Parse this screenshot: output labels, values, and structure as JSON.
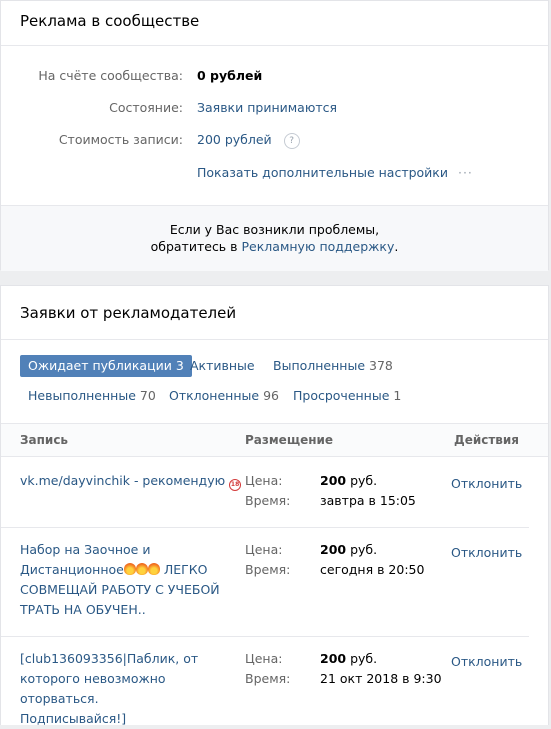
{
  "ads": {
    "title": "Реклама в сообществе",
    "balance": {
      "label": "На счёте сообщества:",
      "value": "0 рублей"
    },
    "status": {
      "label": "Состояние:",
      "value": "Заявки принимаются"
    },
    "price": {
      "label": "Стоимость записи:",
      "value": "200 рублей",
      "help_icon": "?"
    },
    "more_settings": "Показать дополнительные настройки",
    "more_icon": "···",
    "support_line1": "Если у Вас возникли проблемы,",
    "support_prefix": "обратитесь в",
    "support_link": "Рекламную поддержку",
    "support_suffix": "."
  },
  "requests": {
    "title": "Заявки от рекламодателей",
    "tabs": [
      {
        "label": "Ожидает публикации",
        "count": "3",
        "active": true
      },
      {
        "label": "Активные",
        "count": ""
      },
      {
        "label": "Выполненные",
        "count": "378"
      },
      {
        "label": "Невыполненные",
        "count": "70"
      },
      {
        "label": "Отклоненные",
        "count": "96"
      },
      {
        "label": "Просроченные",
        "count": "1"
      }
    ],
    "columns": {
      "post": "Запись",
      "placement": "Размещение",
      "actions": "Действия"
    },
    "price_label": "Цена:",
    "time_label": "Время:",
    "currency": "руб.",
    "reject_label": "Отклонить",
    "rows": [
      {
        "post_text": "vk.me/dayvinchik - рекомендую",
        "post_icon": "age-18-icon",
        "price": "200",
        "time": "завтра в 15:05"
      },
      {
        "post_line1": "Набор на Заочное и",
        "post_line2a": "Дистанционное",
        "post_line2b": " ЛЕГКО",
        "post_line3": "СОВМЕЩАЙ РАБОТУ С УЧЕБОЙ",
        "post_line4": "ТРАТЬ НА ОБУЧЕН..",
        "post_icon": "fire-icon",
        "price": "200",
        "time": "сегодня в 20:50"
      },
      {
        "post_line1": "[club136093356|Паблик, от",
        "post_line2": "которого невозможно оторваться.",
        "post_line3": "Подписывайся!]",
        "price": "200",
        "time": "21 окт 2018 в 9:30"
      }
    ]
  }
}
